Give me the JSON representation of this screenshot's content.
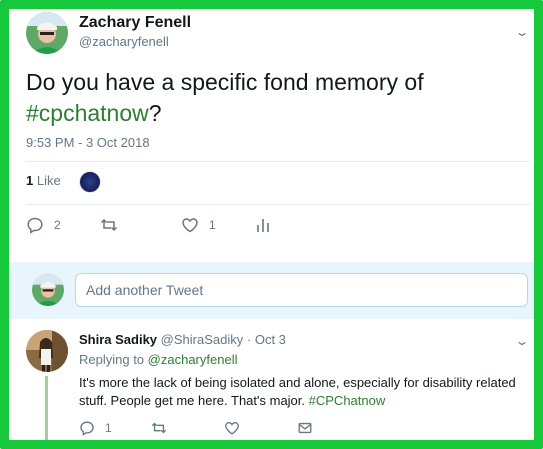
{
  "tweet": {
    "display_name": "Zachary Fenell",
    "handle": "@zacharyfenell",
    "text_main": "Do you have a specific fond memory of",
    "hashtag": "#cpchatnow",
    "text_end": "?",
    "timestamp": "9:53 PM - 3 Oct 2018",
    "like_count": "1",
    "like_label": "Like",
    "actions": {
      "reply_count": "2",
      "retweet_count": "",
      "like_count": "1"
    }
  },
  "compose": {
    "placeholder": "Add another Tweet"
  },
  "reply": {
    "display_name": "Shira Sadiky",
    "handle": "@ShiraSadiky",
    "separator": "·",
    "date": "Oct 3",
    "replying_prefix": "Replying to",
    "replying_to": "@zacharyfenell",
    "text": "It's more the lack of being isolated and alone, especially for disability related stuff. People get me here. That's major.",
    "hashtag": "#CPChatnow",
    "actions": {
      "reply_count": "1"
    }
  },
  "colors": {
    "frame": "#17c93a",
    "hashtag": "#2e7d32",
    "muted": "#657786",
    "compose_bg": "#e8f5fd"
  },
  "icons": [
    "reply-icon",
    "retweet-icon",
    "like-icon",
    "analytics-icon",
    "message-icon",
    "chevron-down-icon"
  ]
}
